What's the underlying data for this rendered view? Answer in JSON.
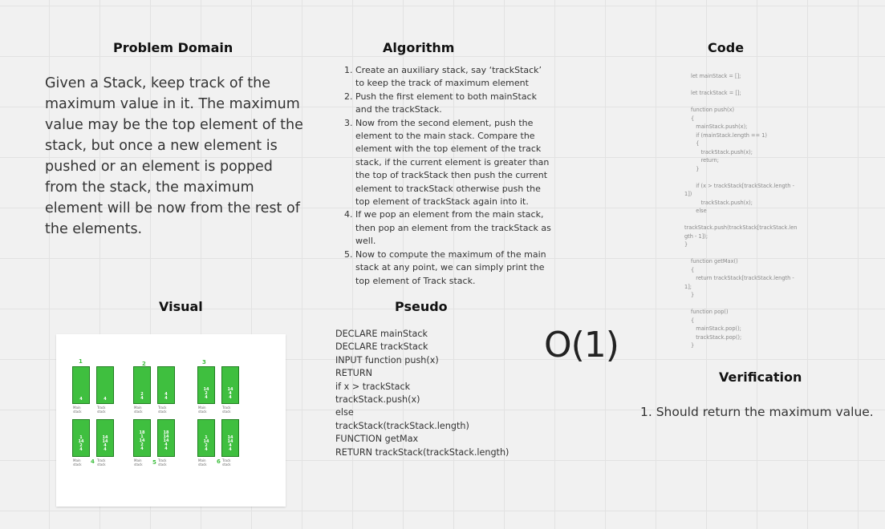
{
  "headings": {
    "problem_domain": "Problem Domain",
    "algorithm": "Algorithm",
    "code": "Code",
    "visual": "Visual",
    "pseudo": "Pseudo",
    "verification": "Verification"
  },
  "problem_text": "Given a Stack, keep track of the maximum value in it. The maximum value may be the top element of the stack, but once a new element is pushed or an element is popped from the stack, the maximum element will be now from the rest of the elements.",
  "algorithm_steps": [
    "Create an auxiliary stack, say ‘trackStack’ to keep the track of maximum element",
    "Push the first element to both mainStack and the trackStack.",
    "Now from the second element, push the element to the main stack. Compare the element with the top element of the track stack, if the current element is greater than the top of trackStack then push the current element to trackStack otherwise push the top element of trackStack again into it.",
    "If we pop an element from the main stack, then pop an element from the trackStack as well.",
    "Now to compute the maximum of the main stack at any point, we can simply print the top element of Track stack."
  ],
  "code_lines": [
    "let mainStack = [];",
    "",
    "let trackStack = [];",
    "",
    "function push(x)",
    "{",
    "   mainStack.push(x);",
    "   if (mainStack.length == 1)",
    "   {",
    "      trackStack.push(x);",
    "      return;",
    "   }",
    "",
    "   if (x > trackStack[trackStack.length -",
    "1])",
    "      trackStack.push(x);",
    "   else",
    "",
    "trackStack.push(trackStack[trackStack.len",
    "gth - 1]);",
    "}",
    "",
    "function getMax()",
    "{",
    "   return trackStack[trackStack.length -",
    "1];",
    "}",
    "",
    "function pop()",
    "{",
    "   mainStack.pop();",
    "   trackStack.pop();",
    "}"
  ],
  "pseudo_lines": [
    "DECLARE mainStack",
    "DECLARE trackStack",
    "INPUT function push(x)",
    "RETURN",
    "if x > trackStack",
    "trackStack.push(x)",
    "else",
    "trackStack(trackStack.length)",
    "FUNCTION getMax",
    "RETURN trackStack(trackStack.length)"
  ],
  "complexity": "O(1)",
  "verification_items": [
    "1. Should return the maximum value."
  ],
  "visual": {
    "colors": {
      "fill": "#3fbf3f",
      "border": "#1f7f1f"
    },
    "steps": [
      "1",
      "2",
      "3",
      "4",
      "5",
      "6"
    ],
    "labels": {
      "main": "Main\nstack",
      "track": "Track\nstack"
    },
    "stacks": [
      [
        "4"
      ],
      [
        "4"
      ],
      [
        "2",
        "4"
      ],
      [
        "4",
        "4"
      ],
      [
        "14",
        "2",
        "4"
      ],
      [
        "14",
        "4",
        "4"
      ],
      [
        "1",
        "14",
        "2",
        "4"
      ],
      [
        "14",
        "14",
        "4",
        "4"
      ],
      [
        "18",
        "1",
        "14",
        "2",
        "4"
      ],
      [
        "18",
        "14",
        "14",
        "4",
        "4"
      ],
      [
        "1",
        "14",
        "2",
        "4"
      ],
      [
        "14",
        "14",
        "4",
        "4"
      ]
    ]
  }
}
